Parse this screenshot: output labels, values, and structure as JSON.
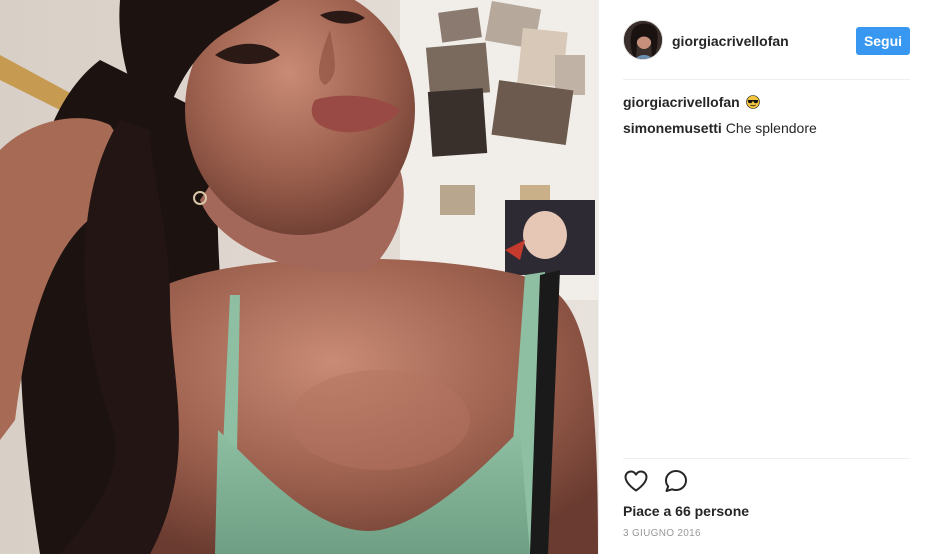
{
  "post": {
    "photo_alt": "",
    "header": {
      "username": "giorgiacrivellofan",
      "follow_label": "Segui"
    },
    "comments": [
      {
        "author": "giorgiacrivellofan",
        "text": "",
        "emoji": "sunglasses-emoji"
      },
      {
        "author": "simonemusetti",
        "text": "Che splendore"
      }
    ],
    "actions": {
      "like_icon": "heart-icon",
      "comment_icon": "comment-bubble-icon"
    },
    "likes_text": "Piace a 66 persone",
    "date_text": "3 GIUGNO 2016"
  }
}
